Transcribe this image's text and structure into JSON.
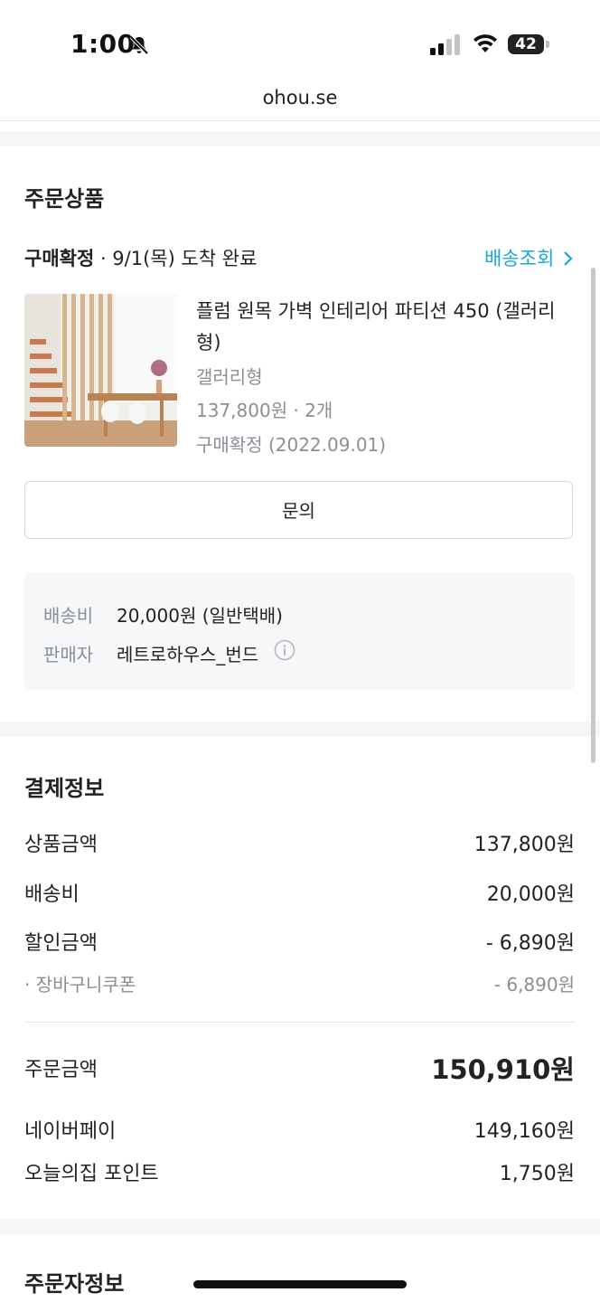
{
  "status_bar": {
    "time": "1:00",
    "battery": "42"
  },
  "browser": {
    "url": "ohou.se"
  },
  "order_items": {
    "title": "주문상품",
    "status_bold": "구매확정",
    "status_rest": " · 9/1(목) 도착 완료",
    "track_link": "배송조회",
    "product": {
      "name": "플럼 원목 가벽 인테리어 파티션 450 (갤러리형)",
      "option": "갤러리형",
      "price_qty": "137,800원 · 2개",
      "confirm": "구매확정 (2022.09.01)"
    },
    "inquiry_button": "문의",
    "shipping_label": "배송비",
    "shipping_value": "20,000원 (일반택배)",
    "seller_label": "판매자",
    "seller_value": "레트로하우스_번드"
  },
  "payment": {
    "title": "결제정보",
    "rows": [
      {
        "label": "상품금액",
        "value": "137,800원"
      },
      {
        "label": "배송비",
        "value": "20,000원"
      },
      {
        "label": "할인금액",
        "value": "- 6,890원"
      },
      {
        "label": "· 장바구니쿠폰",
        "value": "- 6,890원"
      }
    ],
    "total_label": "주문금액",
    "total_value": "150,910원",
    "methods": [
      {
        "label": "네이버페이",
        "value": "149,160원"
      },
      {
        "label": "오늘의집 포인트",
        "value": "1,750원"
      }
    ]
  },
  "orderer": {
    "title": "주문자정보"
  },
  "colors": {
    "link": "#1aa7de",
    "muted": "#8a8f96",
    "band": "#f5f6f8"
  }
}
